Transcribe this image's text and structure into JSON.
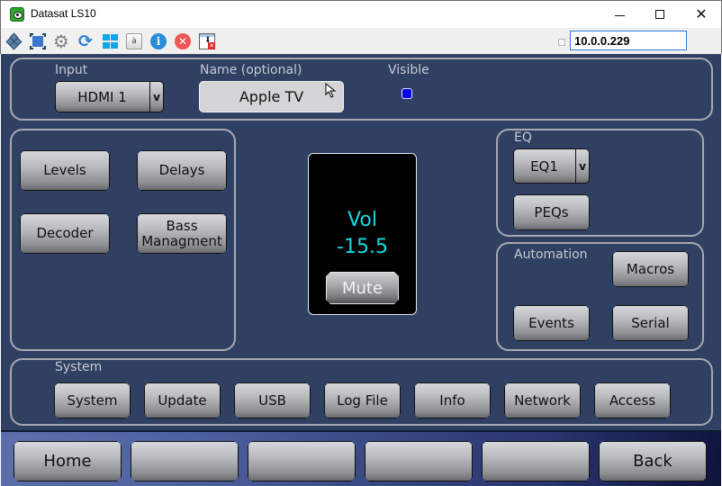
{
  "window": {
    "title": "Datasat LS10",
    "controls": [
      "minimize",
      "maximize",
      "close"
    ],
    "close_glyph": "✕"
  },
  "toolbar": {
    "icons": [
      "modules-icon",
      "fullscreen-icon",
      "gear-icon",
      "refresh-icon",
      "windows-icon",
      "keyboard-icon",
      "info-icon",
      "stop-icon",
      "download-icon"
    ],
    "gear_glyph": "⚙",
    "refresh_glyph": "⟳",
    "keyboard_glyph": "à",
    "info_glyph": "i",
    "stop_glyph": "✕",
    "download_arrow_glyph": "⬇",
    "download_x_glyph": "✕",
    "ip_address": "10.0.0.229"
  },
  "input_section": {
    "input_label": "Input",
    "input_value": "HDMI 1",
    "name_label": "Name (optional)",
    "name_value": "Apple TV",
    "visible_label": "Visible",
    "visible_checked": true,
    "chevron_glyph": "v"
  },
  "audio_section": {
    "buttons": [
      "Levels",
      "Delays",
      "Decoder",
      "Bass\nManagment"
    ]
  },
  "volume": {
    "label": "Vol",
    "value": "-15.5",
    "mute_label": "Mute"
  },
  "eq_section": {
    "label": "EQ",
    "eq_value": "EQ1",
    "chevron_glyph": "v",
    "peqs_label": "PEQs"
  },
  "automation_section": {
    "label": "Automation",
    "macros_label": "Macros",
    "events_label": "Events",
    "serial_label": "Serial"
  },
  "system_section": {
    "label": "System",
    "buttons": [
      "System",
      "Update",
      "USB",
      "Log File",
      "Info",
      "Network",
      "Access"
    ]
  },
  "navbar": {
    "buttons": [
      "Home",
      "",
      "",
      "",
      "",
      "Back"
    ]
  },
  "colors": {
    "panel_bg": "#2f4063",
    "volume_text": "#19d7e4",
    "visible_indicator": "#0000f0"
  }
}
